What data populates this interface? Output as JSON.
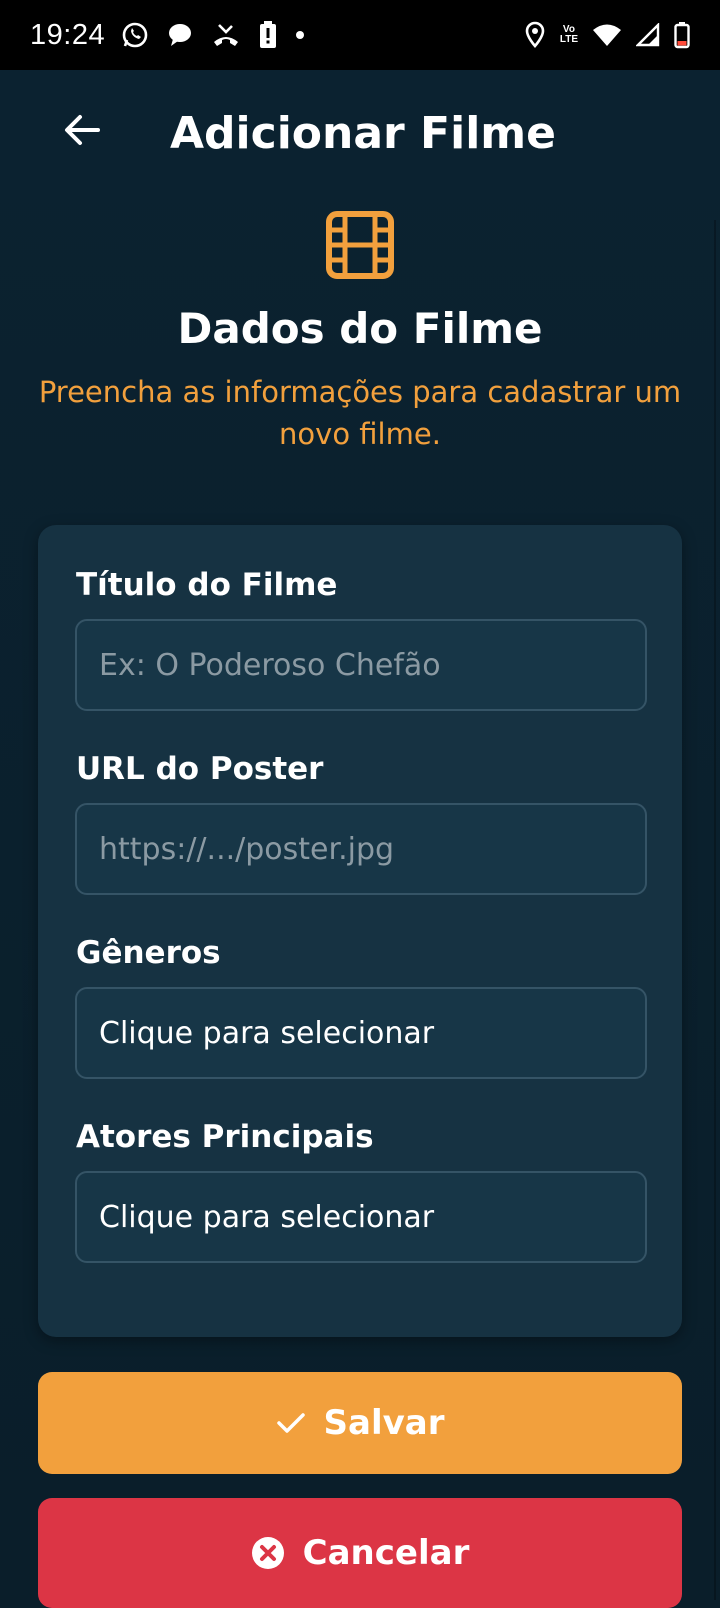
{
  "status_bar": {
    "time": "19:24",
    "volte_line1": "Vo",
    "volte_line2": "LTE",
    "left_icons": [
      "whatsapp-icon",
      "chat-bubble-icon",
      "missed-call-icon",
      "battery-alert-icon",
      "dot-icon"
    ],
    "right_icons": [
      "location-icon",
      "volte-icon",
      "wifi-icon",
      "signal-icon",
      "battery-icon"
    ]
  },
  "header": {
    "title": "Adicionar Filme",
    "back_icon": "arrow-left-icon"
  },
  "hero": {
    "icon": "film-icon",
    "title": "Dados do Filme",
    "subtitle": "Preencha as informações para cadastrar um novo filme."
  },
  "form": {
    "title_label": "Título do Filme",
    "title_placeholder": "Ex: O Poderoso Chefão",
    "title_value": "",
    "poster_label": "URL do Poster",
    "poster_placeholder": "https://.../poster.jpg",
    "poster_value": "",
    "genres_label": "Gêneros",
    "genres_value": "Clique para selecionar",
    "actors_label": "Atores Principais",
    "actors_value": "Clique para selecionar"
  },
  "actions": {
    "save_label": "Salvar",
    "save_icon": "check-icon",
    "cancel_label": "Cancelar",
    "cancel_icon": "close-circle-icon"
  },
  "colors": {
    "accent": "#f2a03d",
    "danger": "#dc3545",
    "background": "#0a1f2b",
    "card": "#163242"
  }
}
